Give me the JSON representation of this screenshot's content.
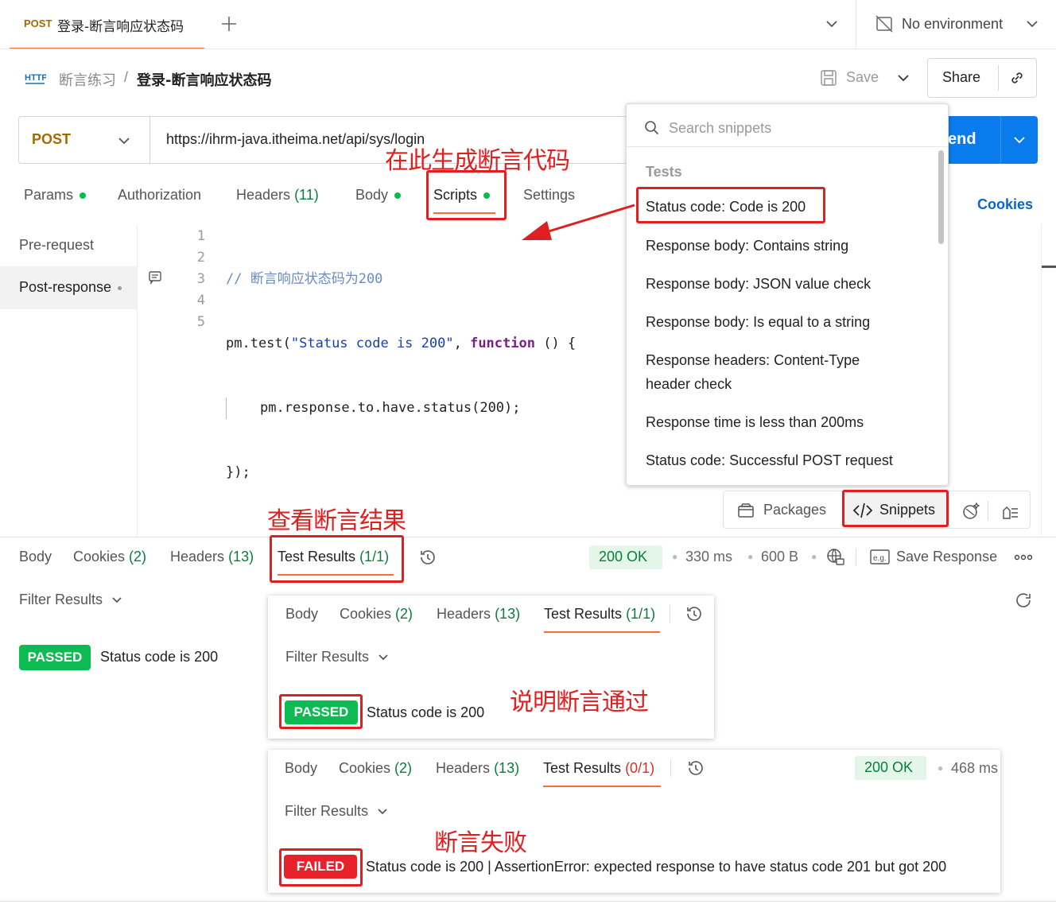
{
  "tab": {
    "method": "POST",
    "title": "登录-断言响应状态码"
  },
  "environment": {
    "label": "No environment"
  },
  "breadcrumb": {
    "collection": "断言练习",
    "separator": "/",
    "request": "登录-断言响应状态码"
  },
  "toolbar": {
    "save_label": "Save",
    "share_label": "Share"
  },
  "request": {
    "method": "POST",
    "url": "https://ihrm-java.itheima.net/api/sys/login",
    "send_label": "end"
  },
  "request_tabs": {
    "params": "Params",
    "authorization": "Authorization",
    "headers": "Headers",
    "headers_count": "(11)",
    "body": "Body",
    "scripts": "Scripts",
    "settings": "Settings",
    "cookies": "Cookies"
  },
  "script_sidebar": {
    "pre": "Pre-request",
    "post": "Post-response"
  },
  "code": {
    "line_numbers": [
      "1",
      "2",
      "3",
      "4",
      "5"
    ],
    "l1": "// 断言响应状态码为200",
    "l2_a": "pm.test(",
    "l2_str": "\"Status code is 200\"",
    "l2_b": ", ",
    "l2_kw": "function",
    "l2_c": " () {",
    "l3": "pm.response.to.have.status(200);",
    "l4": "});"
  },
  "snippets": {
    "search_placeholder": "Search snippets",
    "section": "Tests",
    "items": [
      "Status code: Code is 200",
      "Response body: Contains string",
      "Response body: JSON value check",
      "Response body: Is equal to a string",
      "Response headers: Content-Type",
      "header check",
      "Response time is less than 200ms",
      "Status code: Successful POST request"
    ],
    "packages_label": "Packages",
    "snippets_label": "Snippets"
  },
  "annotations": {
    "generate": "在此生成断言代码",
    "view": "查看断言结果",
    "passed_note": "说明断言通过",
    "failed_note": "断言失败"
  },
  "response": {
    "tabs": {
      "body": "Body",
      "cookies": "Cookies",
      "cookies_count": "(2)",
      "headers": "Headers",
      "headers_count": "(13)",
      "test_results": "Test Results",
      "test_count": "(1/1)"
    },
    "status": "200 OK",
    "time": "330 ms",
    "size": "600 B",
    "save_response": "Save Response",
    "filter": "Filter Results",
    "result_badge": "PASSED",
    "result_text": "Status code is 200"
  },
  "inset_passed": {
    "tabs": [
      "Body",
      "Cookies",
      "Headers",
      "Test Results"
    ],
    "cookies_count": "(2)",
    "headers_count": "(13)",
    "test_count": "(1/1)",
    "filter": "Filter Results",
    "badge": "PASSED",
    "text": "Status code is 200"
  },
  "inset_failed": {
    "tabs": [
      "Body",
      "Cookies",
      "Headers",
      "Test Results"
    ],
    "cookies_count": "(2)",
    "headers_count": "(13)",
    "test_count": "(0/1)",
    "status": "200 OK",
    "time": "468 ms",
    "filter": "Filter Results",
    "badge": "FAILED",
    "text": "Status code is 200 | AssertionError: expected response to have status code 201 but got 200"
  },
  "colors": {
    "accent": "#ff6c37",
    "send": "#097bed",
    "passed": "#0cbb52",
    "failed": "#e8212b",
    "annotation": "#e02020"
  }
}
